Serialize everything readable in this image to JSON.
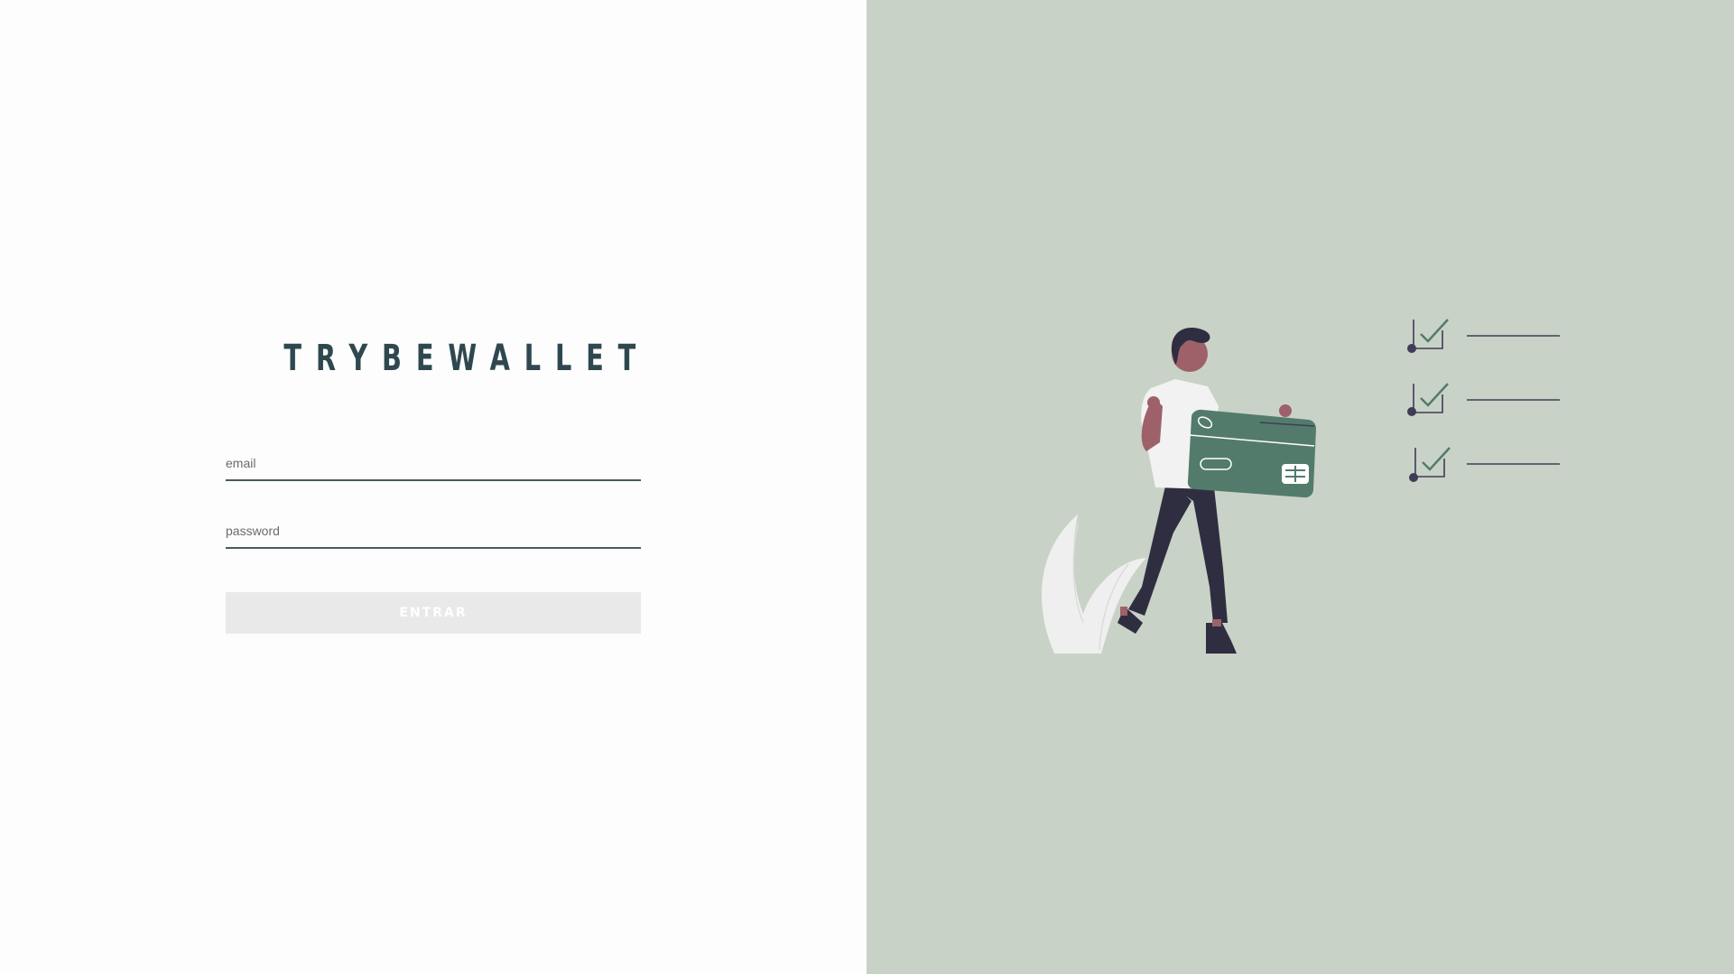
{
  "app": {
    "title": "TRYBEWALLET"
  },
  "login": {
    "email_placeholder": "email",
    "email_value": "",
    "password_placeholder": "password",
    "password_value": "",
    "submit_label": "ENTRAR"
  },
  "colors": {
    "left_background": "#fdfdfd",
    "right_background": "#c9d2c6",
    "brand_text": "#2f4850",
    "card": "#537b6c",
    "button_disabled": "#e9e9e9"
  },
  "illustration": {
    "icon": "person-holding-credit-card-with-checklist",
    "checklist_items": 3
  }
}
